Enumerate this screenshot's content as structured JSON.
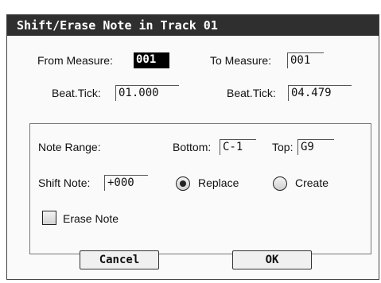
{
  "dialog": {
    "title": "Shift/Erase Note in Track 01",
    "from_measure": {
      "label": "From Measure:",
      "value": "001"
    },
    "to_measure": {
      "label": "To Measure:",
      "value": "001"
    },
    "from_beat_tick": {
      "label": "Beat.Tick:",
      "value": "01.000"
    },
    "to_beat_tick": {
      "label": "Beat.Tick:",
      "value": "04.479"
    },
    "note_range": {
      "label": "Note Range:",
      "bottom_label": "Bottom:",
      "bottom_value": "C-1",
      "top_label": "Top:",
      "top_value": "G9"
    },
    "shift_note": {
      "label": "Shift Note:",
      "value": "+000"
    },
    "mode": {
      "options": [
        "Replace",
        "Create"
      ],
      "selected": "Replace"
    },
    "erase_note": {
      "label": "Erase Note",
      "checked": false
    },
    "buttons": {
      "cancel": "Cancel",
      "ok": "OK"
    }
  }
}
